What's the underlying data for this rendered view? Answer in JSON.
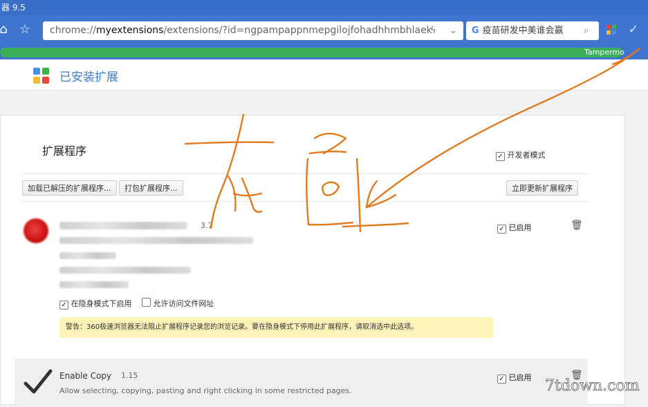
{
  "window": {
    "title": "器 9.5"
  },
  "toolbar": {
    "address_prefix": "chrome://",
    "address_host": "myextensions",
    "address_path": "/extensions/?id=ngpampappnmepgilojfohadhhmbhlaek",
    "search_text": "疫苗研发中美谁会赢"
  },
  "bookmarks": {
    "tampermonkey_label": "Tampermo"
  },
  "header": {
    "title": "已安装扩展"
  },
  "extensions_page": {
    "section_title": "扩展程序",
    "developer_mode_label": "开发者模式",
    "developer_mode_checked": true,
    "load_unpacked_button": "加载已解压的扩展程序...",
    "pack_button": "打包扩展程序...",
    "update_button": "立即更新扩展程序"
  },
  "extension1": {
    "version": "3.7",
    "enabled_label": "已启用",
    "incognito_label": "在隐身模式下启用",
    "incognito_checked": true,
    "file_urls_label": "允许访问文件网址",
    "file_urls_checked": false,
    "warning": "警告：360极速浏览器无法阻止扩展程序记录您的浏览记录。要在隐身模式下停用此扩展程序，请取消选中此选项。"
  },
  "extension2": {
    "name": "Enable Copy",
    "version": "1.15",
    "enabled_label": "已启用",
    "description": "Allow selecting, copying, pasting and right clicking in some restricted pages."
  },
  "annotation": {
    "stroke_color": "#e07a1f"
  },
  "watermark": {
    "text": "7tdown.com"
  }
}
